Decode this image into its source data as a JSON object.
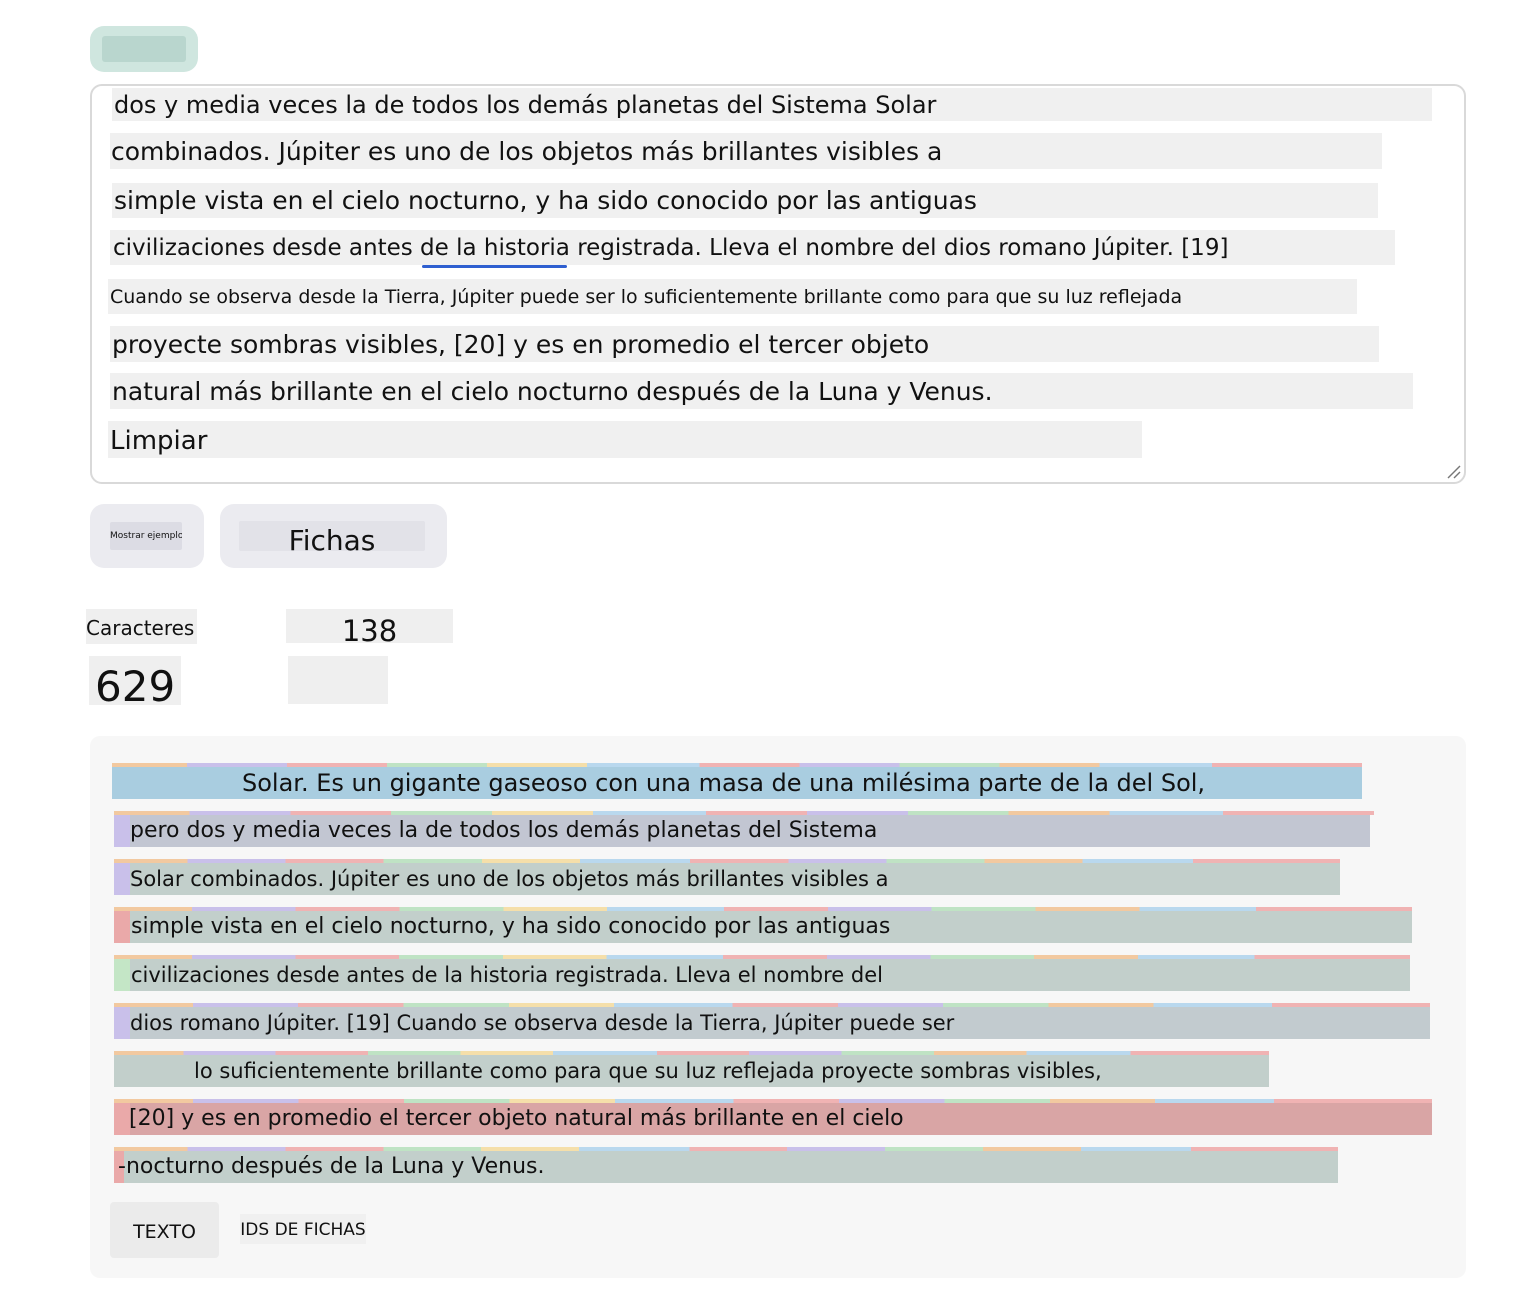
{
  "top_button": {
    "label": ""
  },
  "input_text": {
    "lines": [
      "dos y media veces la de todos los demás planetas del Sistema Solar",
      "combinados. Júpiter es uno de los objetos más brillantes visibles a",
      "simple vista en el cielo nocturno, y ha sido conocido por las antiguas",
      "civilizaciones desde antes de la historia registrada. Lleva el nombre del dios romano Júpiter. [19]",
      "Cuando se observa desde la Tierra, Júpiter puede ser lo suficientemente brillante como para que su luz reflejada",
      "proyecte sombras visibles, [20] y es en promedio el tercer objeto",
      "natural más brillante en el cielo nocturno después de la Luna y Venus.",
      "Limpiar"
    ]
  },
  "buttons": {
    "show_example": "Mostrar ejemplo",
    "tokens": "Fichas"
  },
  "stats": {
    "characters_label": "Caracteres",
    "tokens_value": "138",
    "characters_value": "629",
    "tokens_label": ""
  },
  "output": {
    "lines": [
      "Solar. Es un gigante gaseoso con una masa de una milésima parte de la del Sol,",
      "pero dos y media veces la de todos los demás planetas del Sistema",
      "Solar combinados. Júpiter es uno de los objetos más brillantes visibles a",
      "simple vista en el cielo nocturno, y ha sido conocido por las antiguas",
      "civilizaciones desde antes de la historia registrada. Lleva el nombre del",
      "dios romano Júpiter. [19] Cuando se observa desde la Tierra, Júpiter puede ser",
      "lo suficientemente brillante como para que su luz reflejada proyecte sombras visibles,",
      "[20] y es en promedio el tercer objeto natural más brillante en el cielo",
      "-nocturno después de la Luna y Venus."
    ],
    "colors": {
      "blue": "#a9cde0",
      "purple": "#c9c0ea",
      "gray_green": "#c2cfcb",
      "red": "#d9a5a5",
      "green": "#c4e6c6",
      "pink": "#eaa9a9"
    }
  },
  "tabs": {
    "text": "TEXTO",
    "token_ids": "IDS DE FICHAS"
  }
}
